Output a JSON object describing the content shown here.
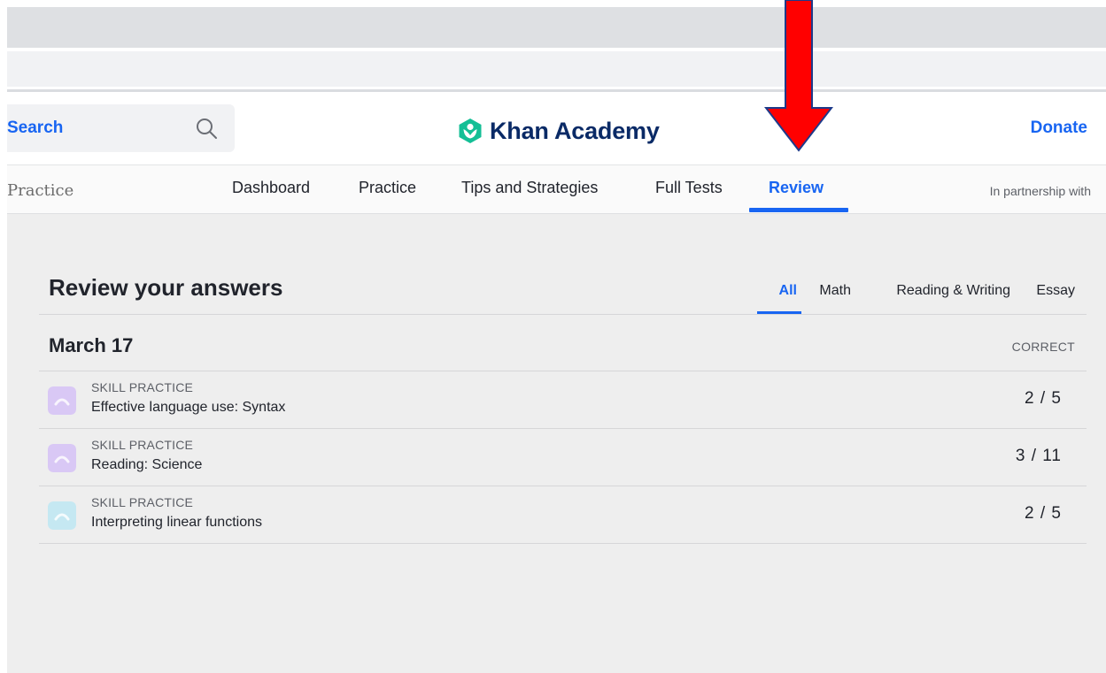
{
  "header": {
    "search_label": "Search",
    "logo_text": "Khan Academy",
    "donate_label": "Donate"
  },
  "subnav": {
    "brand": "Practice",
    "tabs": [
      {
        "label": "Dashboard"
      },
      {
        "label": "Practice"
      },
      {
        "label": "Tips and Strategies"
      },
      {
        "label": "Full Tests"
      },
      {
        "label": "Review",
        "active": true
      }
    ],
    "partner_text": "In partnership with"
  },
  "review": {
    "title": "Review your answers",
    "filters": [
      {
        "label": "All",
        "active": true
      },
      {
        "label": "Math"
      },
      {
        "label": "Reading & Writing"
      },
      {
        "label": "Essay"
      }
    ],
    "date": "March 17",
    "correct_header": "CORRECT",
    "items": [
      {
        "type": "SKILL PRACTICE",
        "title": "Effective language use: Syntax",
        "score": "2 / 5",
        "icon": "reading-writing-icon",
        "icon_color": "#d9c8f5"
      },
      {
        "type": "SKILL PRACTICE",
        "title": "Reading: Science",
        "score": "3 / 11",
        "icon": "reading-writing-icon",
        "icon_color": "#d9c8f5"
      },
      {
        "type": "SKILL PRACTICE",
        "title": "Interpreting linear functions",
        "score": "2 / 5",
        "icon": "math-icon",
        "icon_color": "#c5e8f2"
      }
    ]
  },
  "colors": {
    "brand_blue": "#1865f2",
    "logo_green": "#14bf96",
    "logo_navy": "#0a2a66",
    "arrow_red": "#ff0000"
  }
}
